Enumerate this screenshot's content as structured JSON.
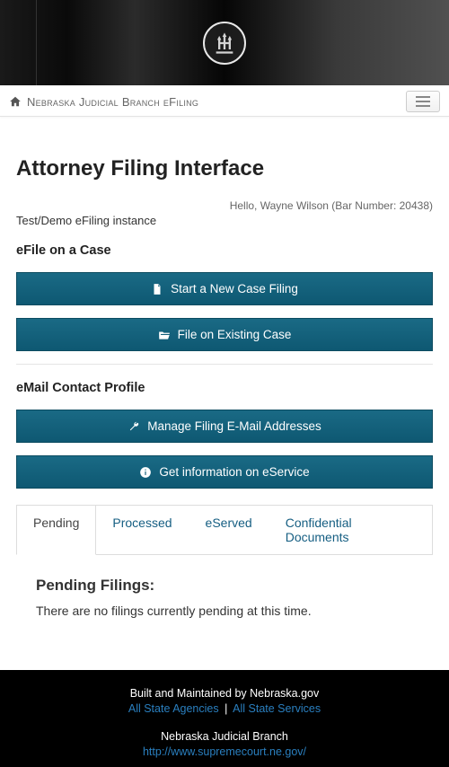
{
  "brand": {
    "site_name": "Nebraska Judicial Branch eFiling"
  },
  "page": {
    "title": "Attorney Filing Interface",
    "greeting": "Hello, Wayne Wilson (Bar Number: 20438)",
    "instance_note": "Test/Demo eFiling instance"
  },
  "sections": {
    "efile": {
      "heading": "eFile on a Case",
      "buttons": {
        "new_case": "Start a New Case Filing",
        "existing_case": "File on Existing Case"
      }
    },
    "email": {
      "heading": "eMail Contact Profile",
      "buttons": {
        "manage": "Manage Filing E-Mail Addresses",
        "eservice_info": "Get information on eService"
      }
    }
  },
  "tabs": {
    "items": [
      {
        "label": "Pending"
      },
      {
        "label": "Processed"
      },
      {
        "label": "eServed"
      },
      {
        "label": "Confidential Documents"
      }
    ],
    "active_index": 0
  },
  "pending_panel": {
    "heading": "Pending Filings:",
    "empty_message": "There are no filings currently pending at this time."
  },
  "footer": {
    "built_by": "Built and Maintained by Nebraska.gov",
    "link_agencies": "All State Agencies",
    "link_services": "All State Services",
    "branch_label": "Nebraska Judicial Branch",
    "branch_url": "http://www.supremecourt.ne.gov/"
  }
}
